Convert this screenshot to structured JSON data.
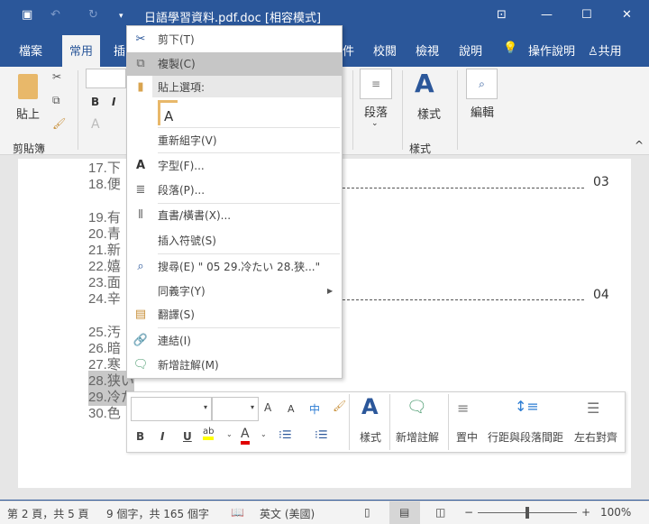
{
  "window": {
    "title": "日語學習資料.pdf.doc [相容模式]"
  },
  "ribbon": {
    "tabs": [
      "檔案",
      "常用",
      "插",
      "件",
      "校閱",
      "檢視",
      "說明"
    ],
    "active_tab": "常用",
    "tell_me": "操作說明",
    "share": "共用",
    "paste": "貼上",
    "clipboard_group": "剪貼簿",
    "paragraph": "段落",
    "styles": "樣式",
    "styles_group": "樣式",
    "editing": "編輯",
    "bold": "B",
    "italic": "I",
    "font_color": "A"
  },
  "document": {
    "lines": [
      "17.下",
      "18.便",
      "19.有",
      "20.青",
      "21.新",
      "22.嬉",
      "23.面",
      "24.辛",
      "25.汚",
      "26.暗",
      "27.寒",
      "28.狭い",
      "29.冷た",
      "30.色"
    ],
    "page_numbers": [
      "03",
      "04"
    ]
  },
  "context_menu": {
    "items": [
      {
        "label": "剪下(T)",
        "icon": "scissors-icon"
      },
      {
        "label": "複製(C)",
        "icon": "copy-icon",
        "highlighted": true
      },
      {
        "label": "貼上選項:",
        "icon": "paste-icon"
      },
      {
        "label": "重新組字(V)"
      },
      {
        "label": "字型(F)...",
        "icon": "font-icon"
      },
      {
        "label": "段落(P)...",
        "icon": "paragraph-icon"
      },
      {
        "label": "直書/橫書(X)...",
        "icon": "text-direction-icon"
      },
      {
        "label": "插入符號(S)"
      },
      {
        "label": "搜尋(E) \" 05  29.冷たい  28.狭...\"",
        "icon": "search-icon"
      },
      {
        "label": "同義字(Y)",
        "submenu": true
      },
      {
        "label": "翻譯(S)",
        "icon": "translate-icon"
      },
      {
        "label": "連結(I)",
        "icon": "link-icon"
      },
      {
        "label": "新增註解(M)",
        "icon": "new-comment-icon"
      }
    ]
  },
  "mini_toolbar": {
    "font_name": "",
    "font_size": "",
    "grow": "A",
    "shrink": "A",
    "phonetic": "中",
    "bold": "B",
    "italic": "I",
    "underline": "U",
    "highlight": "ab",
    "font_color": "A",
    "styles": "樣式",
    "new_comment": "新增註解",
    "center": "置中",
    "line_spacing": "行距與段落間距",
    "justify": "左右對齊",
    "highlight_color": "#ffff00",
    "font_color_value": "#e00000"
  },
  "status": {
    "page": "第 2 頁，共 5 頁",
    "words": "9 個字，共 165 個字",
    "language": "英文 (美國)",
    "zoom": "100%",
    "zoom_level": 100
  },
  "colors": {
    "accent": "#2b579a"
  }
}
